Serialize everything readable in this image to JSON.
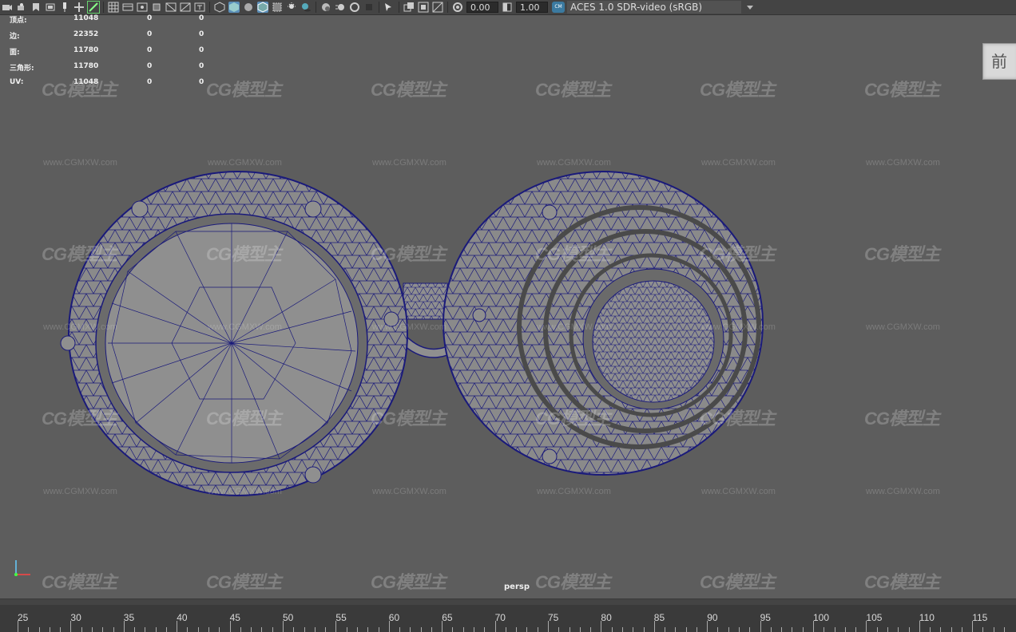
{
  "toolbar": {
    "gamma_value": "0.00",
    "exposure_value": "1.00",
    "cm_badge": "CM",
    "color_space": "ACES 1.0 SDR-video (sRGB)"
  },
  "hud": {
    "rows": [
      {
        "label": "顶点:",
        "v1": "11048",
        "v2": "0",
        "v3": "0"
      },
      {
        "label": "边:",
        "v1": "22352",
        "v2": "0",
        "v3": "0"
      },
      {
        "label": "面:",
        "v1": "11780",
        "v2": "0",
        "v3": "0"
      },
      {
        "label": "三角形:",
        "v1": "11780",
        "v2": "0",
        "v3": "0"
      },
      {
        "label": "UV:",
        "v1": "11048",
        "v2": "0",
        "v3": "0"
      }
    ]
  },
  "viewcube_label": "前",
  "camera_label": "persp",
  "watermark": {
    "logo_text": "CG模型主",
    "url_text": "www.CGMXW.com"
  },
  "timeslider": {
    "ticks": [
      "25",
      "30",
      "35",
      "40",
      "45",
      "50",
      "55",
      "60",
      "65",
      "70",
      "75",
      "80",
      "85",
      "90",
      "95",
      "100",
      "105",
      "110",
      "115"
    ]
  },
  "colors": {
    "viewport_bg": "#5d5d5d",
    "mesh_fill": "#8f8f8f",
    "wire": "#1a1a7a",
    "toolbar_bg": "#444444"
  }
}
